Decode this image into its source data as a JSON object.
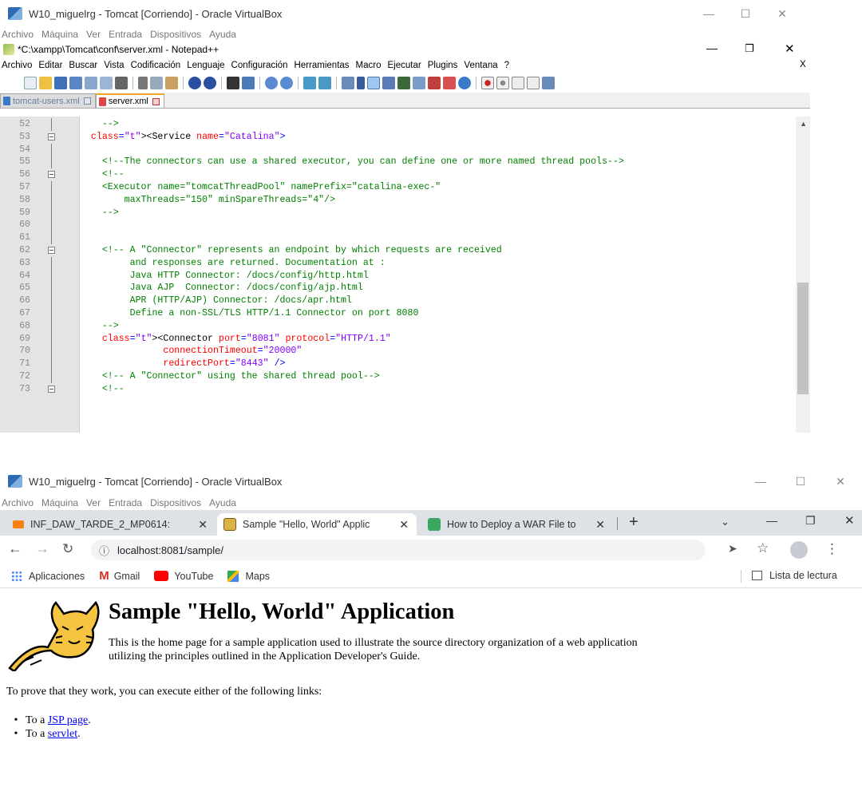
{
  "top": {
    "vb_title": "W10_miguelrg - Tomcat [Corriendo] - Oracle VirtualBox",
    "vb_menu": [
      "Archivo",
      "Máquina",
      "Ver",
      "Entrada",
      "Dispositivos",
      "Ayuda"
    ],
    "npp_title": "*C:\\xampp\\Tomcat\\conf\\server.xml - Notepad++",
    "npp_menu": [
      "Archivo",
      "Editar",
      "Buscar",
      "Vista",
      "Codificación",
      "Lenguaje",
      "Configuración",
      "Herramientas",
      "Macro",
      "Ejecutar",
      "Plugins",
      "Ventana",
      "?"
    ],
    "npp_close_extra": "X",
    "tabs": [
      {
        "label": "tomcat-users.xml"
      },
      {
        "label": "server.xml"
      }
    ],
    "lines": [
      {
        "n": "52",
        "code": "    -->",
        "kind": "c"
      },
      {
        "n": "53",
        "code": "  <Service name=\"Catalina\">",
        "kind": "tag",
        "fold": true
      },
      {
        "n": "54",
        "code": "",
        "kind": "c"
      },
      {
        "n": "55",
        "code": "    <!--The connectors can use a shared executor, you can define one or more named thread pools-->",
        "kind": "c"
      },
      {
        "n": "56",
        "code": "    <!--",
        "kind": "c",
        "fold": true
      },
      {
        "n": "57",
        "code": "    <Executor name=\"tomcatThreadPool\" namePrefix=\"catalina-exec-\"",
        "kind": "c"
      },
      {
        "n": "58",
        "code": "        maxThreads=\"150\" minSpareThreads=\"4\"/>",
        "kind": "c"
      },
      {
        "n": "59",
        "code": "    -->",
        "kind": "c"
      },
      {
        "n": "60",
        "code": "",
        "kind": "c"
      },
      {
        "n": "61",
        "code": "",
        "kind": "c"
      },
      {
        "n": "62",
        "code": "    <!-- A \"Connector\" represents an endpoint by which requests are received",
        "kind": "c",
        "fold": true
      },
      {
        "n": "63",
        "code": "         and responses are returned. Documentation at :",
        "kind": "c"
      },
      {
        "n": "64",
        "code": "         Java HTTP Connector: /docs/config/http.html",
        "kind": "c"
      },
      {
        "n": "65",
        "code": "         Java AJP  Connector: /docs/config/ajp.html",
        "kind": "c"
      },
      {
        "n": "66",
        "code": "         APR (HTTP/AJP) Connector: /docs/apr.html",
        "kind": "c"
      },
      {
        "n": "67",
        "code": "         Define a non-SSL/TLS HTTP/1.1 Connector on port 8080",
        "kind": "c"
      },
      {
        "n": "68",
        "code": "    -->",
        "kind": "c"
      },
      {
        "n": "69",
        "code": "    <Connector port=\"8081\" protocol=\"HTTP/1.1\"",
        "kind": "tag"
      },
      {
        "n": "70",
        "code": "               connectionTimeout=\"20000\"",
        "kind": "tag"
      },
      {
        "n": "71",
        "code": "               redirectPort=\"8443\" />",
        "kind": "tag"
      },
      {
        "n": "72",
        "code": "    <!-- A \"Connector\" using the shared thread pool-->",
        "kind": "c"
      },
      {
        "n": "73",
        "code": "    <!--",
        "kind": "c",
        "fold": true
      }
    ]
  },
  "bottom": {
    "vb_title": "W10_miguelrg - Tomcat [Corriendo] - Oracle VirtualBox",
    "vb_menu": [
      "Archivo",
      "Máquina",
      "Ver",
      "Entrada",
      "Dispositivos",
      "Ayuda"
    ],
    "tabs": [
      {
        "label": "INF_DAW_TARDE_2_MP0614:"
      },
      {
        "label": "Sample \"Hello, World\" Applic"
      },
      {
        "label": "How to Deploy a WAR File to"
      }
    ],
    "url": "localhost:8081/sample/",
    "bookmarks": [
      "Aplicaciones",
      "Gmail",
      "YouTube",
      "Maps"
    ],
    "reading_list": "Lista de lectura",
    "page": {
      "heading": "Sample \"Hello, World\" Application",
      "intro_1": "This is the home page for a sample application used to illustrate the source directory organization of a web application",
      "intro_2": "utilizing the principles outlined in the Application Developer's Guide.",
      "prove": "To prove that they work, you can execute either of the following links:",
      "item_prefix": "To a ",
      "links": [
        "JSP page",
        "servlet"
      ],
      "dot": "."
    }
  }
}
